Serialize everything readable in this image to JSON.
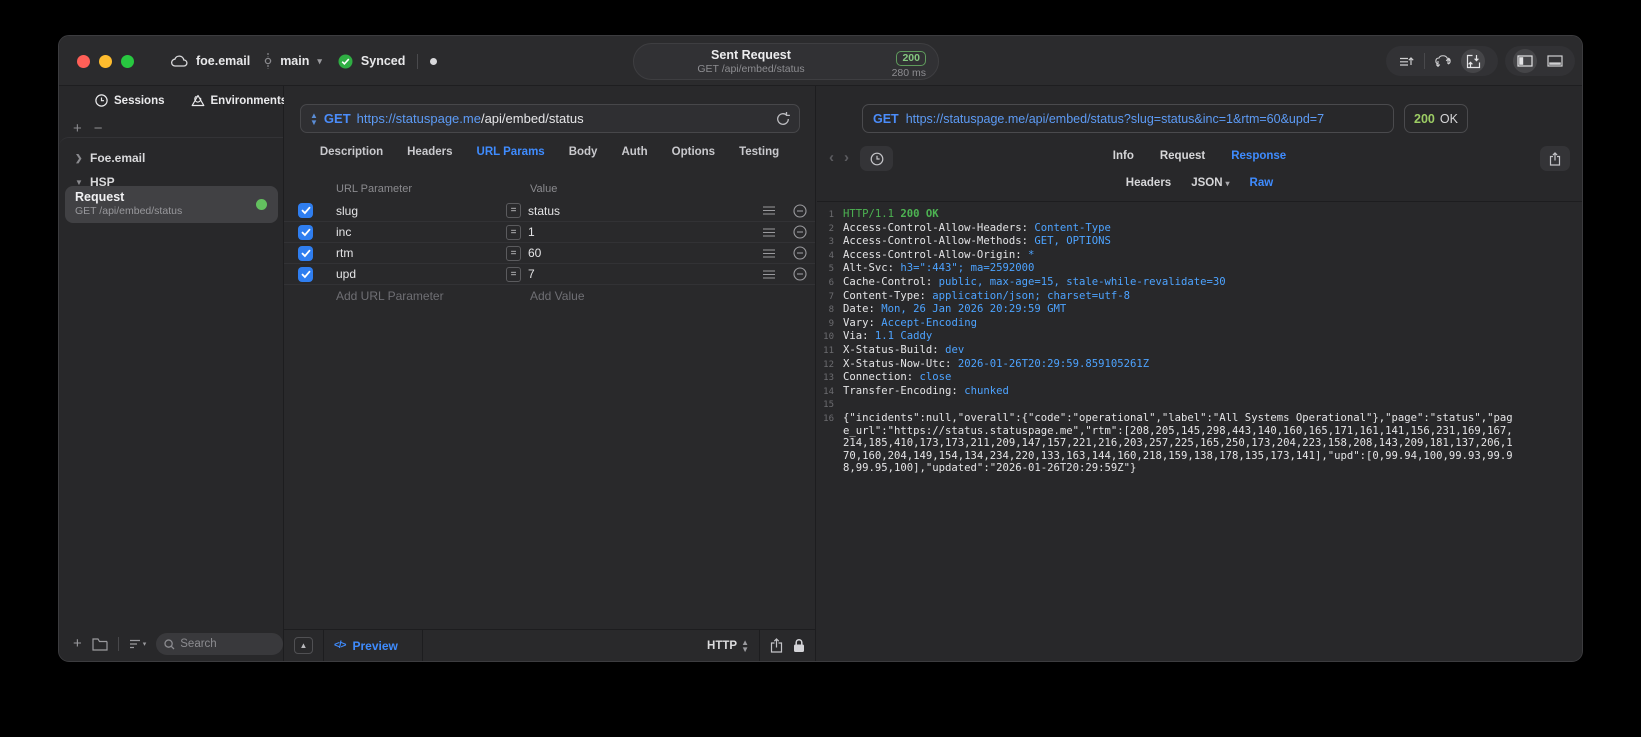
{
  "titlebar": {
    "project": "foe.email",
    "branch": "main",
    "sync_status": "Synced",
    "request_title": "Sent Request",
    "request_subtitle": "GET /api/embed/status",
    "status_code": "200",
    "duration": "280 ms"
  },
  "sidebar": {
    "tabs": [
      {
        "label": "Sessions",
        "icon": "clock-icon"
      },
      {
        "label": "Environments",
        "icon": "environments-icon"
      }
    ],
    "tree": [
      {
        "label": "Foe.email",
        "chevron": "›"
      },
      {
        "label": "HSP",
        "chevron": "⌄"
      }
    ],
    "selected_request": {
      "title": "Request",
      "subtitle": "GET /api/embed/status",
      "dot_color": "#63c05f"
    },
    "search_placeholder": "Search"
  },
  "request_editor": {
    "method": "GET",
    "url_host": "https://statuspage.me",
    "url_path": "/api/embed/status",
    "tabs": [
      "Description",
      "Headers",
      "URL Params",
      "Body",
      "Auth",
      "Options",
      "Testing"
    ],
    "active_tab": "URL Params",
    "params": {
      "columns": [
        "URL Parameter",
        "Value"
      ],
      "rows": [
        {
          "enabled": true,
          "name": "slug",
          "value": "status"
        },
        {
          "enabled": true,
          "name": "inc",
          "value": "1"
        },
        {
          "enabled": true,
          "name": "rtm",
          "value": "60"
        },
        {
          "enabled": true,
          "name": "upd",
          "value": "7"
        }
      ],
      "add_name_placeholder": "Add URL Parameter",
      "add_value_placeholder": "Add Value"
    },
    "footer": {
      "preview_label": "Preview",
      "code_glyph": "</>",
      "protocol_label": "HTTP"
    }
  },
  "response_viewer": {
    "method": "GET",
    "url": "https://statuspage.me/api/embed/status?slug=status&inc=1&rtm=60&upd=7",
    "status_code": "200",
    "status_text": "OK",
    "tabs": [
      "Info",
      "Request",
      "Response"
    ],
    "active_tab": "Response",
    "subtabs": [
      "Headers",
      "JSON",
      "Raw"
    ],
    "active_subtab": "Raw",
    "dropdown_subtab": "JSON",
    "body": {
      "http_version": "HTTP/1.1",
      "status_line": "200 OK",
      "headers": [
        {
          "name": "Access-Control-Allow-Headers",
          "value": "Content-Type"
        },
        {
          "name": "Access-Control-Allow-Methods",
          "value": "GET, OPTIONS"
        },
        {
          "name": "Access-Control-Allow-Origin",
          "value": "*"
        },
        {
          "name": "Alt-Svc",
          "value": "h3=\":443\"; ma=2592000"
        },
        {
          "name": "Cache-Control",
          "value": "public, max-age=15, stale-while-revalidate=30"
        },
        {
          "name": "Content-Type",
          "value": "application/json; charset=utf-8"
        },
        {
          "name": "Date",
          "value": "Mon, 26 Jan 2026 20:29:59 GMT"
        },
        {
          "name": "Vary",
          "value": "Accept-Encoding"
        },
        {
          "name": "Via",
          "value": "1.1 Caddy"
        },
        {
          "name": "X-Status-Build",
          "value": "dev"
        },
        {
          "name": "X-Status-Now-Utc",
          "value": "2026-01-26T20:29:59.859105261Z"
        },
        {
          "name": "Connection",
          "value": "close"
        },
        {
          "name": "Transfer-Encoding",
          "value": "chunked"
        }
      ],
      "json_text": "{\"incidents\":null,\"overall\":{\"code\":\"operational\",\"label\":\"All Systems Operational\"},\"page\":\"status\",\"page_url\":\"https://status.statuspage.me\",\"rtm\":[208,205,145,298,443,140,160,165,171,161,141,156,231,169,167,214,185,410,173,173,211,209,147,157,221,216,203,257,225,165,250,173,204,223,158,208,143,209,181,137,206,170,160,204,149,154,134,234,220,133,163,144,160,218,159,138,178,135,173,141],\"upd\":[0,99.94,100,99.93,99.98,99.95,100],\"updated\":\"2026-01-26T20:29:59Z\"}"
    }
  },
  "colors": {
    "accent_blue": "#3f8cff",
    "url_blue": "#5d9bf5",
    "response_green": "#4db352",
    "badge_green": "#84c77f",
    "checkbox_blue": "#2f7ef0"
  }
}
